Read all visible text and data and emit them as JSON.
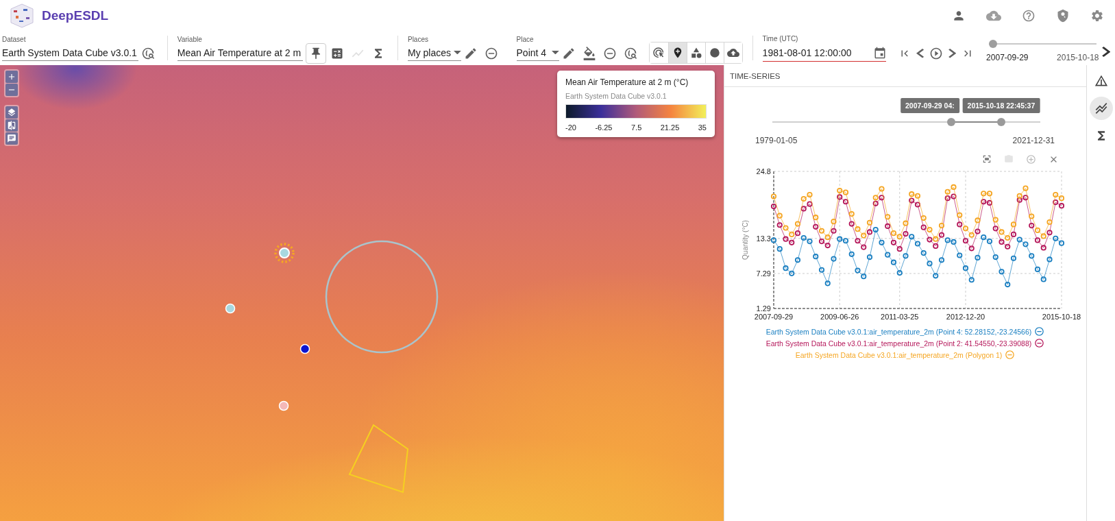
{
  "app": {
    "title": "DeepESDL"
  },
  "toolbar": {
    "dataset": {
      "label": "Dataset",
      "value": "Earth System Data Cube v3.0.1"
    },
    "variable": {
      "label": "Variable",
      "value": "Mean Air Temperature at 2 m"
    },
    "variable_tools": [
      {
        "kind": "pin",
        "selected": true,
        "disabled": false
      },
      {
        "kind": "calculator",
        "selected": false,
        "disabled": false
      },
      {
        "kind": "timeseries",
        "selected": false,
        "disabled": true
      },
      {
        "kind": "statistics",
        "selected": false,
        "disabled": false
      }
    ],
    "places": {
      "label": "Places",
      "value": "My places"
    },
    "place": {
      "label": "Place",
      "value": "Point 4"
    },
    "map_tools": [
      {
        "kind": "select",
        "selected": false
      },
      {
        "kind": "point",
        "selected": true
      },
      {
        "kind": "polygon",
        "selected": false
      },
      {
        "kind": "circle",
        "selected": false
      },
      {
        "kind": "upload",
        "selected": false
      }
    ],
    "time": {
      "label": "Time (UTC)",
      "value": "1981-08-01 12:00:00"
    },
    "time_slider": {
      "level": 0.04,
      "start": "2007-09-29",
      "end": "2015-10-18"
    }
  },
  "map": {
    "legend": {
      "title": "Mean Air Temperature at 2 m (°C)",
      "subtitle": "Earth System Data Cube v3.0.1",
      "ticks": [
        "-20",
        "-6.25",
        "7.5",
        "21.25",
        "35"
      ]
    },
    "markers": [
      {
        "color": "#a8d8e0",
        "selected": true
      },
      {
        "color": "#a8d8e0",
        "selected": false
      },
      {
        "color": "#0a14d0",
        "selected": false
      },
      {
        "color": "#f4b8b8",
        "selected": false
      }
    ]
  },
  "panel": {
    "title": "TIME-SERIES",
    "range_slider": {
      "start_label": "1979-01-05",
      "end_label": "2021-12-31",
      "thumbs": [
        {
          "level": 0.667,
          "tooltip": "2007-09-29 04:"
        },
        {
          "level": 0.854,
          "tooltip": "2015-10-18 22:45:37"
        }
      ]
    },
    "chart_data": {
      "type": "line",
      "grid": true,
      "ylabel": "Quantity (°C)",
      "ylim": [
        1.29,
        24.8
      ],
      "yticks": [
        1.29,
        7.29,
        13.3,
        24.8
      ],
      "categories": [
        "2007-09-29",
        null,
        null,
        null,
        null,
        null,
        null,
        null,
        null,
        null,
        null,
        "2009-06-26",
        null,
        null,
        null,
        null,
        null,
        null,
        null,
        null,
        null,
        "2011-03-25",
        null,
        null,
        null,
        null,
        null,
        null,
        null,
        null,
        null,
        null,
        "2012-12-20",
        null,
        null,
        null,
        null,
        null,
        null,
        null,
        null,
        null,
        null,
        null,
        null,
        null,
        null,
        null,
        "2015-10-18"
      ],
      "series": [
        {
          "name": "Earth System Data Cube v3.0.1:air_temperature_2m (Point 4: 52.28152,-23.24566)",
          "color": "#1a7fc1",
          "marker": "o",
          "values": [
            13.0,
            11.5,
            8.2,
            7.3,
            9.6,
            13.4,
            12.8,
            10.2,
            7.9,
            5.6,
            9.8,
            13.2,
            12.9,
            10.6,
            7.8,
            6.8,
            10.1,
            14.8,
            12.6,
            10.5,
            9.2,
            7.4,
            10.3,
            13.6,
            12.4,
            10.8,
            9.0,
            6.9,
            9.6,
            13.0,
            12.7,
            10.4,
            8.2,
            6.2,
            10.0,
            13.5,
            12.8,
            10.1,
            7.6,
            5.4,
            9.9,
            13.1,
            12.3,
            10.3,
            8.0,
            6.3,
            9.7,
            13.3,
            12.5
          ]
        },
        {
          "name": "Earth System Data Cube v3.0.1:air_temperature_2m (Point 2: 41.54550,-23.39088)",
          "color": "#b5175a",
          "marker": "o",
          "values": [
            18.8,
            15.6,
            13.2,
            12.6,
            14.2,
            18.4,
            19.2,
            15.3,
            12.8,
            12.1,
            14.6,
            20.4,
            19.6,
            15.8,
            12.9,
            11.8,
            14.4,
            19.3,
            20.3,
            15.4,
            12.6,
            11.5,
            14.1,
            19.8,
            19.1,
            15.2,
            13.1,
            12.0,
            13.9,
            20.2,
            20.5,
            15.7,
            12.9,
            11.6,
            14.5,
            19.6,
            19.4,
            15.0,
            12.7,
            11.9,
            14.0,
            19.9,
            20.3,
            15.5,
            13.0,
            11.7,
            14.3,
            19.5,
            18.9
          ]
        },
        {
          "name": "Earth System Data Cube v3.0.1:air_temperature_2m (Polygon 1)",
          "color": "#f5a623",
          "marker": "o",
          "values": [
            20.5,
            17.2,
            15.1,
            14.0,
            15.8,
            20.1,
            20.8,
            16.9,
            14.6,
            13.5,
            16.2,
            21.5,
            21.2,
            17.5,
            14.9,
            13.8,
            16.0,
            20.3,
            21.8,
            17.0,
            14.2,
            13.6,
            15.9,
            20.9,
            20.6,
            16.8,
            14.8,
            13.2,
            15.5,
            21.3,
            22.1,
            17.3,
            15.0,
            13.9,
            16.4,
            21.0,
            21.0,
            16.5,
            14.4,
            13.4,
            15.7,
            20.6,
            21.9,
            17.1,
            14.7,
            13.7,
            16.1,
            20.8,
            20.2
          ]
        }
      ]
    }
  },
  "side_tabs": [
    {
      "kind": "info",
      "selected": false
    },
    {
      "kind": "timeseries",
      "selected": true
    },
    {
      "kind": "statistics",
      "selected": false
    }
  ]
}
